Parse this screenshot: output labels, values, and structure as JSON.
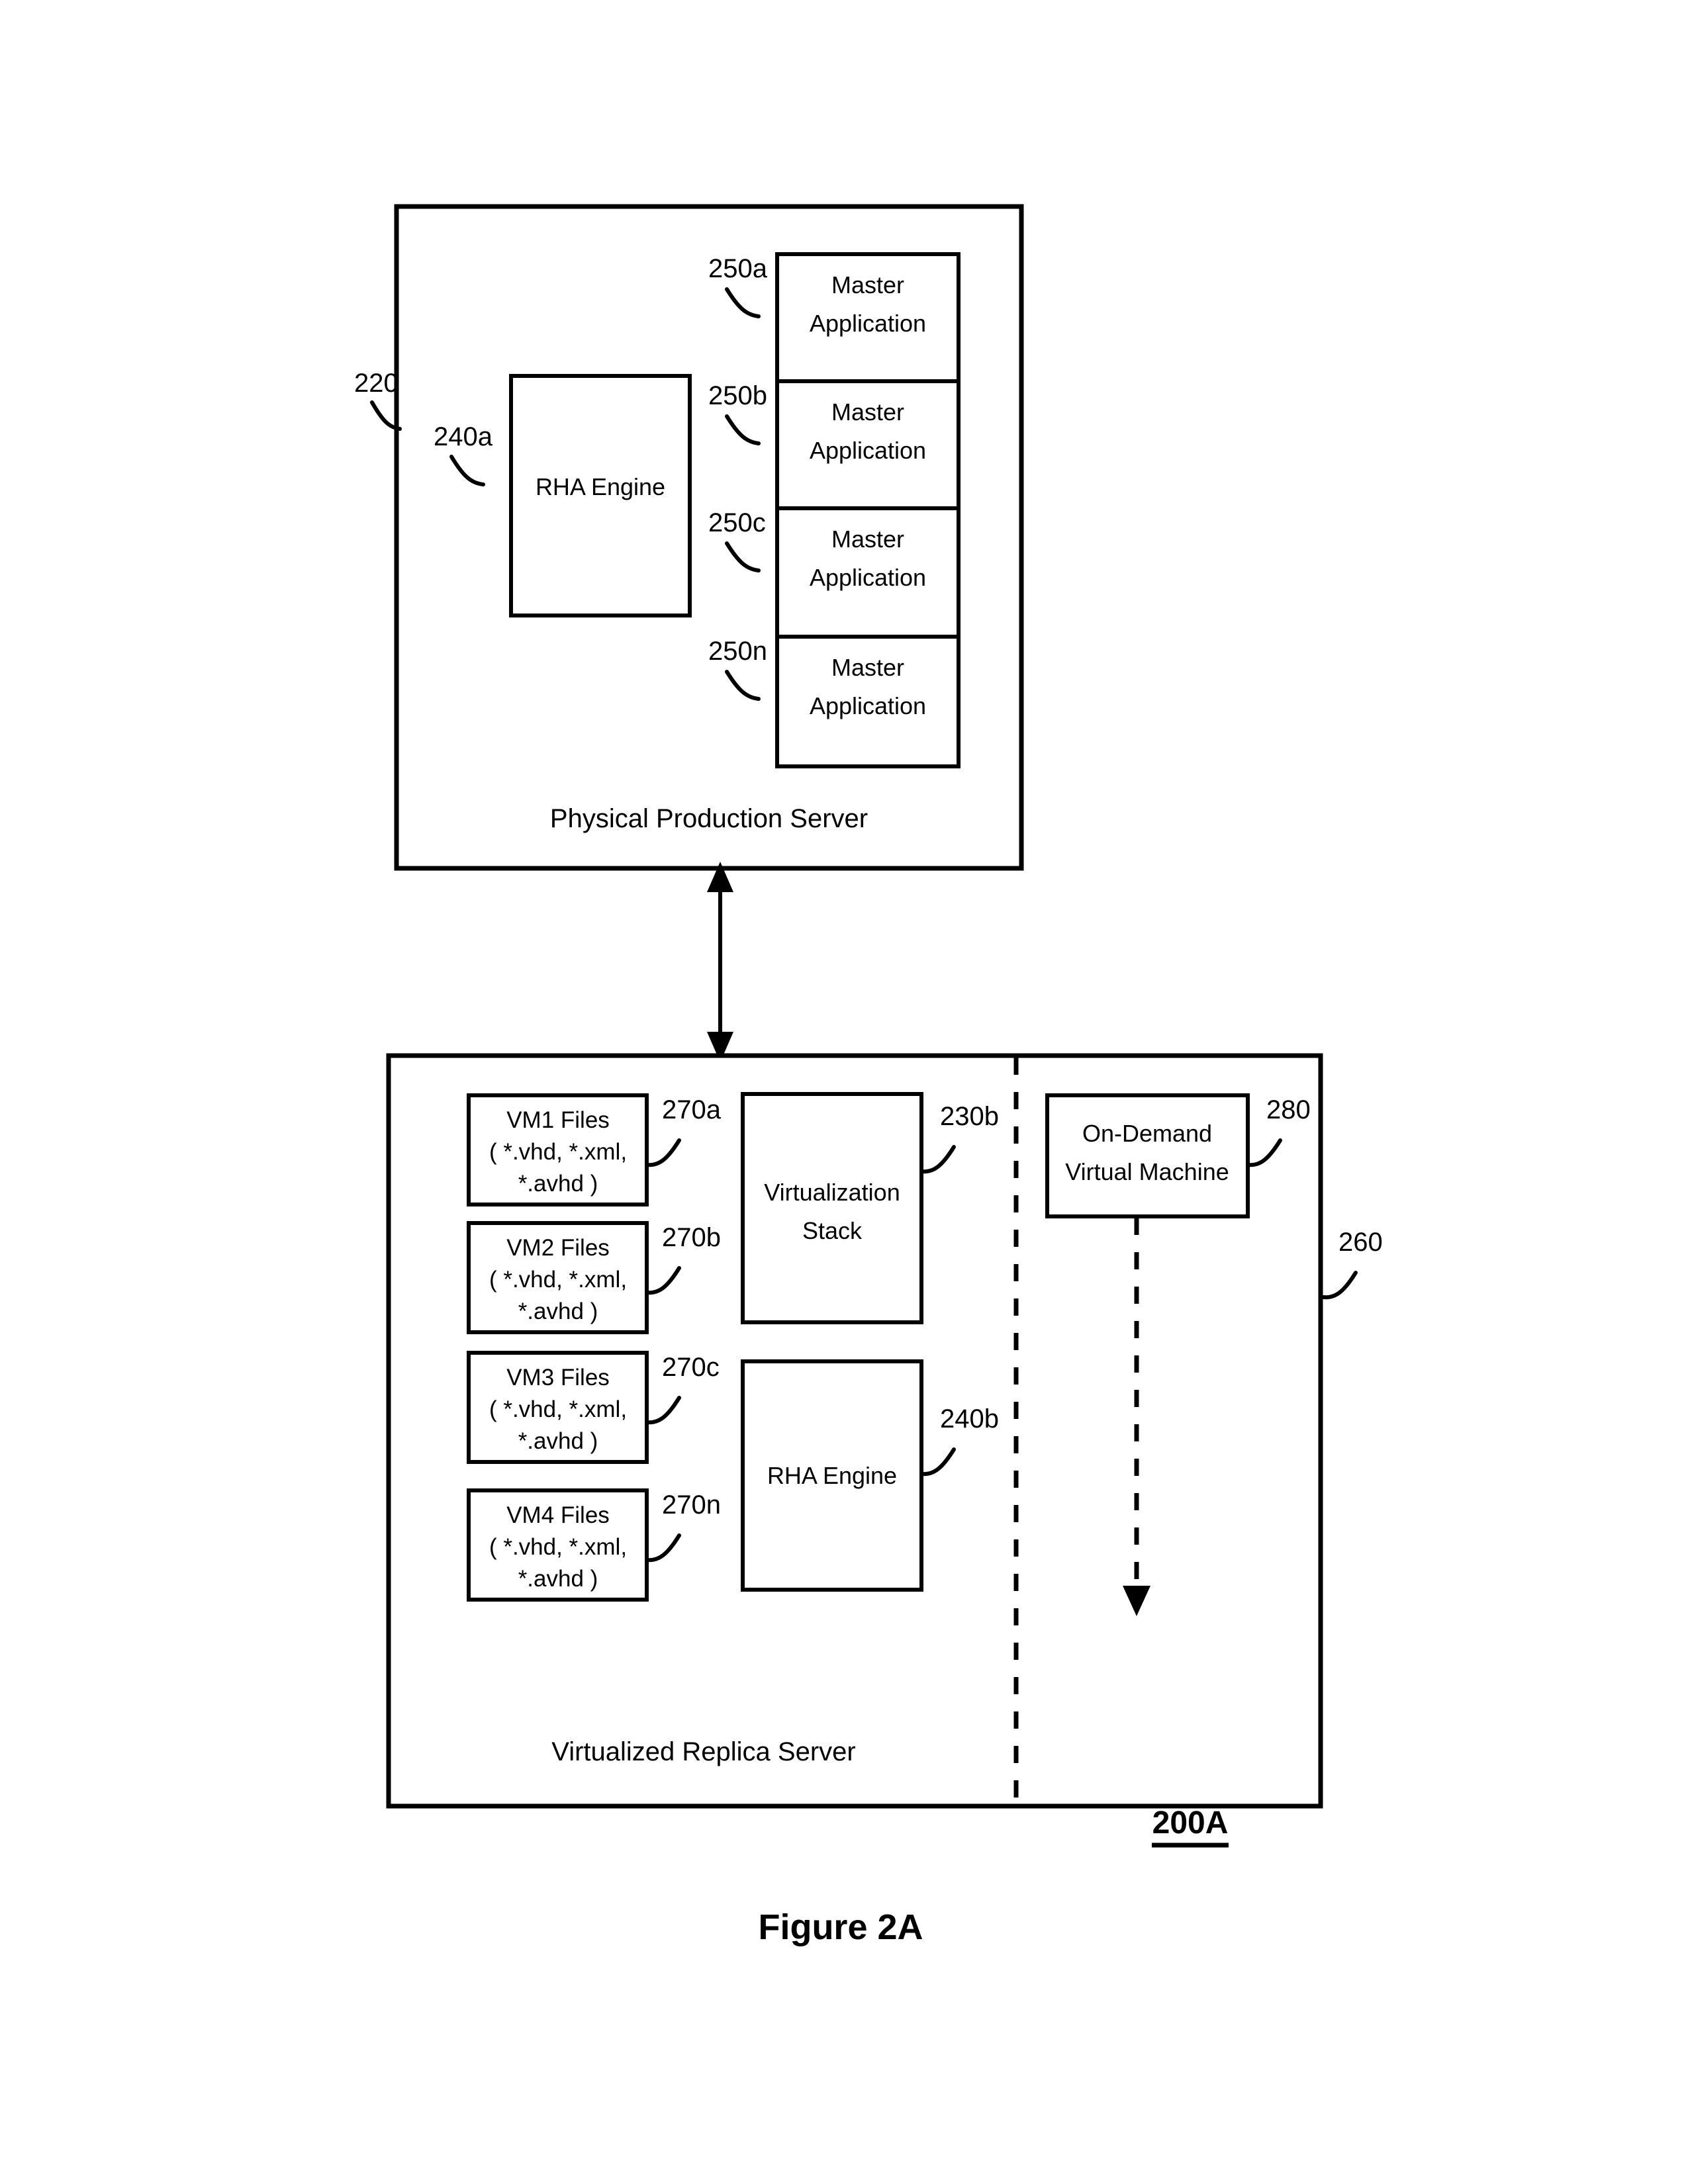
{
  "figure": {
    "caption": "Figure 2A",
    "system_ref": "200A"
  },
  "production_server": {
    "ref": "220",
    "title": "Physical Production Server",
    "engine": {
      "ref": "240a",
      "label": "RHA Engine"
    },
    "applications": [
      {
        "ref": "250a",
        "label_line1": "Master",
        "label_line2": "Application"
      },
      {
        "ref": "250b",
        "label_line1": "Master",
        "label_line2": "Application"
      },
      {
        "ref": "250c",
        "label_line1": "Master",
        "label_line2": "Application"
      },
      {
        "ref": "250n",
        "label_line1": "Master",
        "label_line2": "Application"
      }
    ]
  },
  "replica_server": {
    "ref": "260",
    "title": "Virtualized Replica Server",
    "vm_files": [
      {
        "ref": "270a",
        "line1": "VM1 Files",
        "line2": "( *.vhd, *.xml,",
        "line3": "*.avhd )"
      },
      {
        "ref": "270b",
        "line1": "VM2 Files",
        "line2": "( *.vhd, *.xml,",
        "line3": "*.avhd )"
      },
      {
        "ref": "270c",
        "line1": "VM3 Files",
        "line2": "( *.vhd, *.xml,",
        "line3": "*.avhd )"
      },
      {
        "ref": "270n",
        "line1": "VM4 Files",
        "line2": "( *.vhd, *.xml,",
        "line3": "*.avhd )"
      }
    ],
    "virtualization_stack": {
      "ref": "230b",
      "line1": "Virtualization",
      "line2": "Stack"
    },
    "engine": {
      "ref": "240b",
      "label": "RHA Engine"
    },
    "on_demand_vm": {
      "ref": "280",
      "line1": "On-Demand",
      "line2": "Virtual Machine"
    }
  },
  "colors": {
    "stroke": "#000000",
    "fill": "#ffffff"
  }
}
